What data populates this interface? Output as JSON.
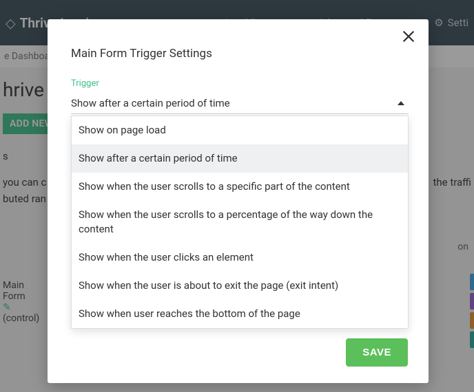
{
  "header": {
    "logo_bold": "Thrive",
    "logo_rest": "Leads",
    "nav": {
      "reports": "Lead Reports",
      "features": "Advanced Features",
      "settings": "Setti"
    }
  },
  "bg": {
    "breadcrumb": "e Dashboard",
    "title": "hrive L",
    "add_button": "ADD NEW F",
    "line0": "s",
    "line1": "you can c",
    "line2": "the traffi",
    "line3": "buted ran",
    "col_right": "on",
    "form_name1": "Main",
    "form_name2": "Form",
    "control": "(control)"
  },
  "modal": {
    "title": "Main Form Trigger Settings",
    "trigger_label": "Trigger",
    "selected": "Show after a certain period of time",
    "options": [
      "Show on page load",
      "Show after a certain period of time",
      "Show when the user scrolls to a specific part of the content",
      "Show when the user scrolls to a percentage of the way down the content",
      "Show when the user clicks an element",
      "Show when the user is about to exit the page (exit intent)",
      "Show when user reaches the bottom of the page"
    ],
    "save": "SAVE"
  },
  "colors": {
    "accent": "#3fbf8d",
    "save": "#5bbf5b",
    "headerbg": "#3a4d5a"
  },
  "chip_colors": [
    "#40a7e0",
    "#9b5fd0",
    "#e39a30",
    "#2aa9a0"
  ]
}
